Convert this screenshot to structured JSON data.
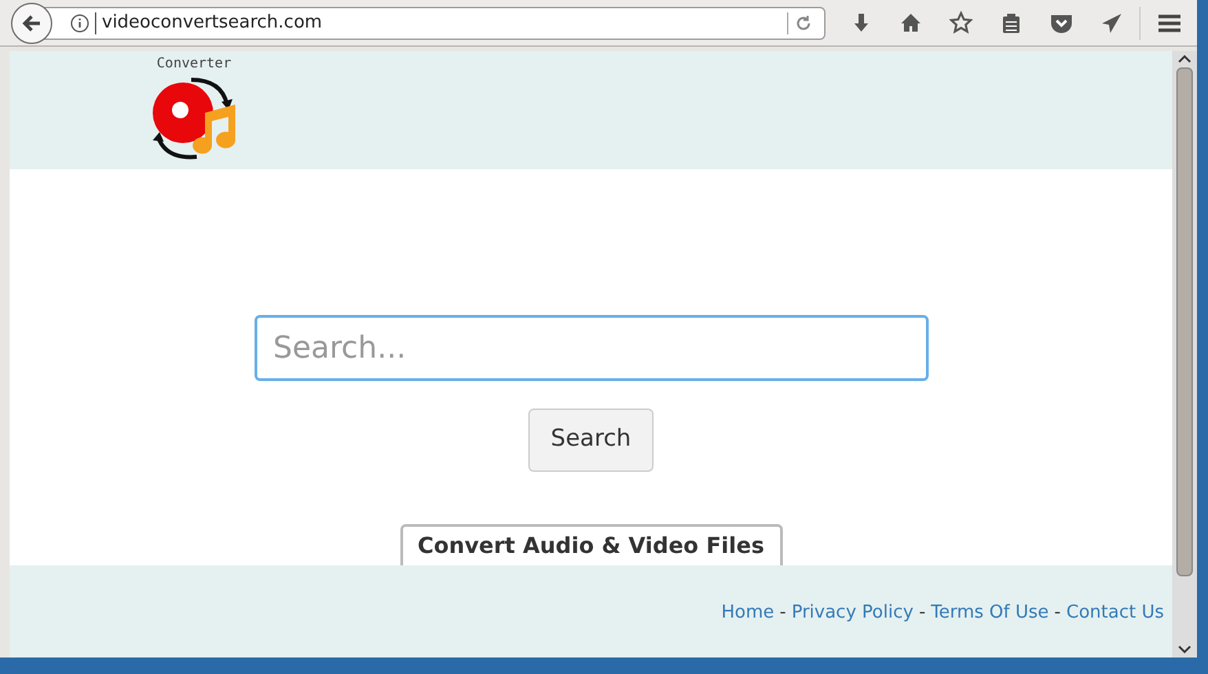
{
  "browser": {
    "url": "videoconvertsearch.com"
  },
  "header": {
    "logo_text": "Converter"
  },
  "search": {
    "placeholder": "Search...",
    "button": "Search"
  },
  "card": {
    "title": "Convert Audio & Video Files"
  },
  "footer": {
    "links": [
      {
        "label": "Home"
      },
      {
        "label": "Privacy Policy"
      },
      {
        "label": "Terms Of Use"
      },
      {
        "label": "Contact Us"
      }
    ],
    "separator": "-"
  }
}
